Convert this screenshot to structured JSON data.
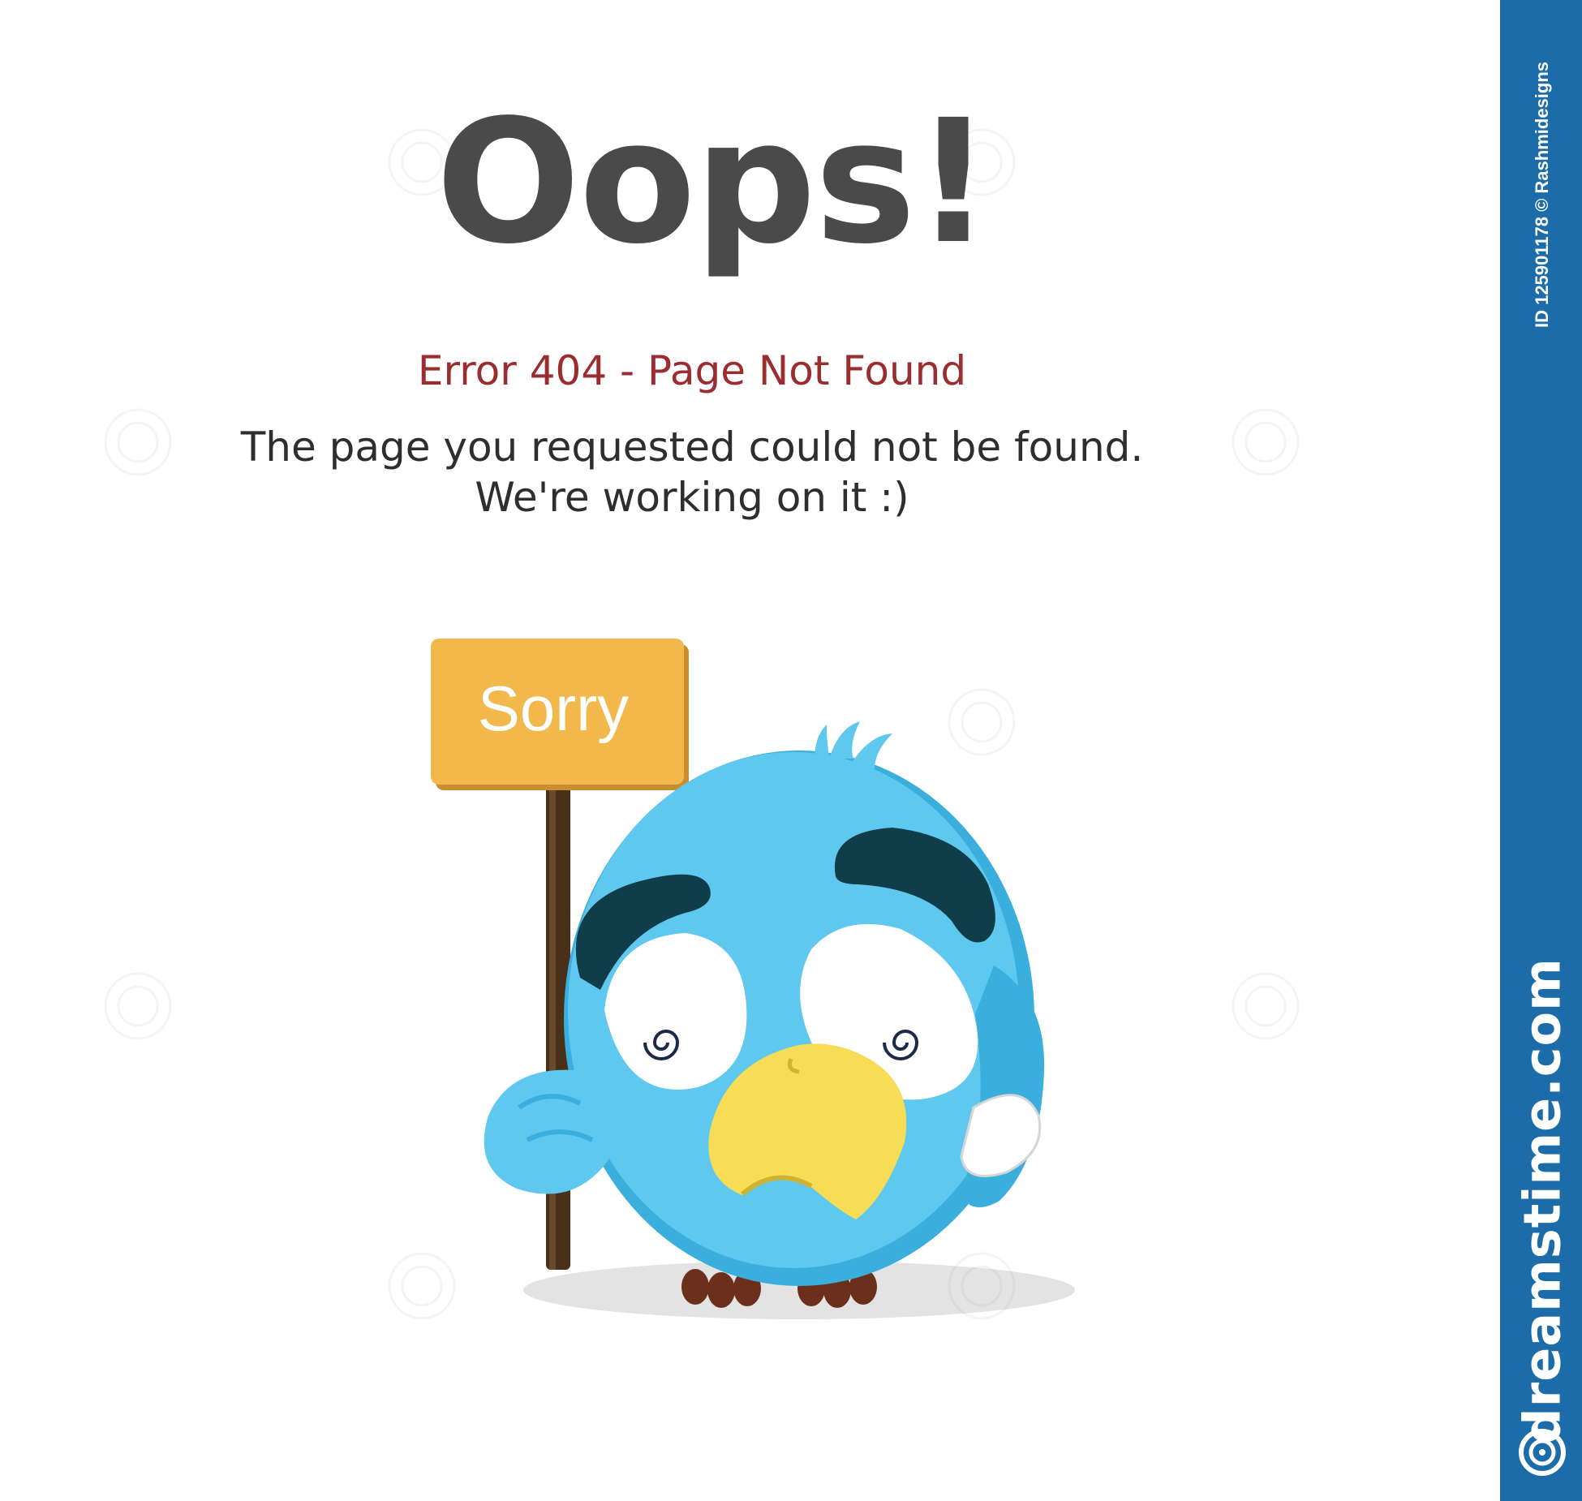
{
  "headline": "Oops!",
  "error_line": "Error 404 - Page Not Found",
  "message": {
    "line1": "The page you requested could not be found.",
    "line2": "We're working on it :)"
  },
  "sign": {
    "label": "Sorry"
  },
  "sidebar": {
    "image_id": "ID 125901178 © Rashmidesigns",
    "brand": "dreamstime.com"
  },
  "colors": {
    "headline": "#4a4a4a",
    "error": "#9b2d30",
    "sign": "#f2b84b",
    "bird": "#5ec8ee",
    "beak": "#f7dd55",
    "sidebar": "#1b6ca8"
  },
  "icons": {
    "sidebar_logo": "dreamstime-swirl-icon"
  }
}
